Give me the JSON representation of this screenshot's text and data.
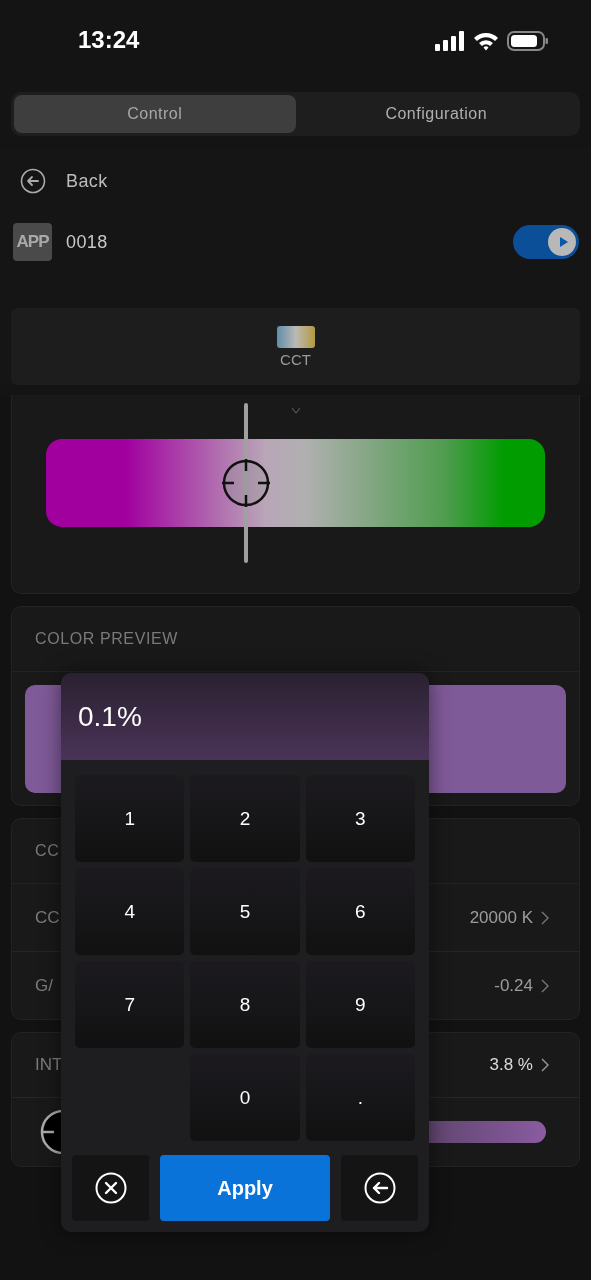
{
  "status_bar": {
    "time": "13:24"
  },
  "tabs": [
    {
      "label": "Control",
      "selected": true
    },
    {
      "label": "Configuration",
      "selected": false
    }
  ],
  "back": {
    "label": "Back"
  },
  "device": {
    "badge": "APP",
    "name": "0018",
    "on": true
  },
  "mode": {
    "label": "CCT"
  },
  "gm_slider": {
    "level": 0.4
  },
  "color_preview": {
    "title": "COLOR PREVIEW"
  },
  "cct_card": {
    "title": "CC",
    "rows": [
      {
        "label": "CC",
        "value": "20000 K"
      },
      {
        "label": "G/",
        "value": "-0.24"
      }
    ]
  },
  "intensity": {
    "title": "INT",
    "value": "3.8 %"
  },
  "keypad": {
    "display": "0.1%",
    "keys": [
      {
        "kind": "digit",
        "label": "1"
      },
      {
        "kind": "digit",
        "label": "2"
      },
      {
        "kind": "digit",
        "label": "3"
      },
      {
        "kind": "digit",
        "label": "4"
      },
      {
        "kind": "digit",
        "label": "5"
      },
      {
        "kind": "digit",
        "label": "6"
      },
      {
        "kind": "digit",
        "label": "7"
      },
      {
        "kind": "digit",
        "label": "8"
      },
      {
        "kind": "digit",
        "label": "9"
      },
      {
        "kind": "blank"
      },
      {
        "kind": "digit",
        "label": "0"
      },
      {
        "kind": "digit",
        "label": "."
      }
    ],
    "apply": "Apply"
  }
}
